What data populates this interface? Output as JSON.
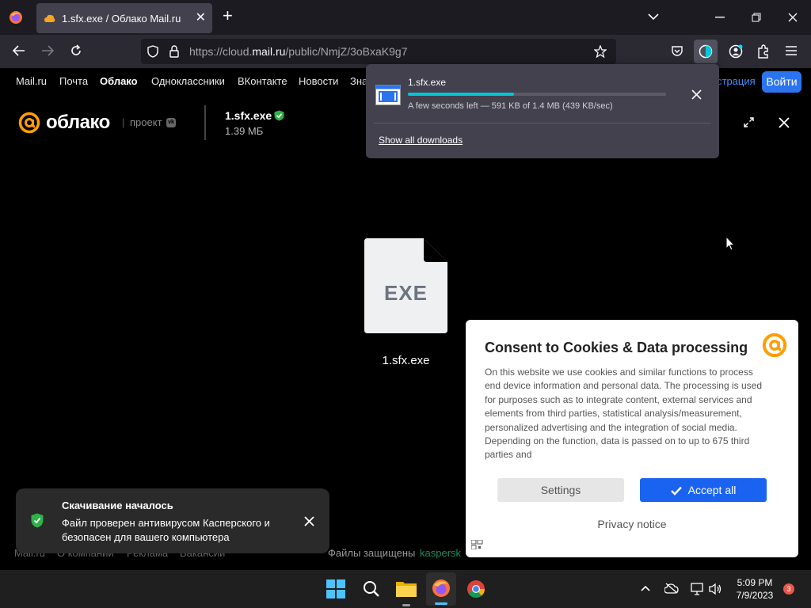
{
  "browser": {
    "tab_title": "1.sfx.exe / Облако Mail.ru",
    "url_prefix": "https://cloud.",
    "url_domain": "mail.ru",
    "url_path": "/public/NmjZ/3oBxaK9g7"
  },
  "site_nav": {
    "items": [
      "Mail.ru",
      "Почта",
      "Облако",
      "Одноклассники",
      "ВКонтакте",
      "Новости",
      "Зна"
    ],
    "register_fragment": "страция",
    "login_label": "Войти"
  },
  "download": {
    "file_name": "1.sfx.exe",
    "progress_fraction": 0.41,
    "status": "A few seconds left — 591 KB of 1.4 MB (439 KB/sec)",
    "show_all_label": "Show all downloads"
  },
  "cloud_header": {
    "logo_text": "облако",
    "project_label": "проект",
    "file_name": "1.sfx.exe",
    "file_size": "1.39 МБ"
  },
  "file_preview": {
    "ext_label": "EXE",
    "caption": "1.sfx.exe"
  },
  "toast": {
    "title": "Скачивание началось",
    "body": "Файл проверен антивирусом Касперского и безопасен для вашего компьютера"
  },
  "footer": {
    "links": [
      "Mail.ru",
      "О компании",
      "Реклама",
      "Вакансии"
    ],
    "protected_label": "Файлы защищены",
    "brand": "kaspersk"
  },
  "consent": {
    "title": "Consent to Cookies & Data processing",
    "text": "On this website we use cookies and similar functions to process end device information and personal data. The processing is used for purposes such as to integrate content, external services and elements from third parties, statistical analysis/measurement, personalized advertising and the integration of social media. Depending on the function, data is passed on to up to 675 third parties and",
    "settings_label": "Settings",
    "accept_label": "Accept all",
    "privacy_label": "Privacy notice"
  },
  "taskbar": {
    "time": "5:09 PM",
    "date": "7/9/2023",
    "notifications": "3"
  },
  "colors": {
    "accent_blue": "#1a63f0",
    "mail_orange": "#ff9e00",
    "progress": "#00c8d7",
    "safe_green": "#2fb24a"
  }
}
